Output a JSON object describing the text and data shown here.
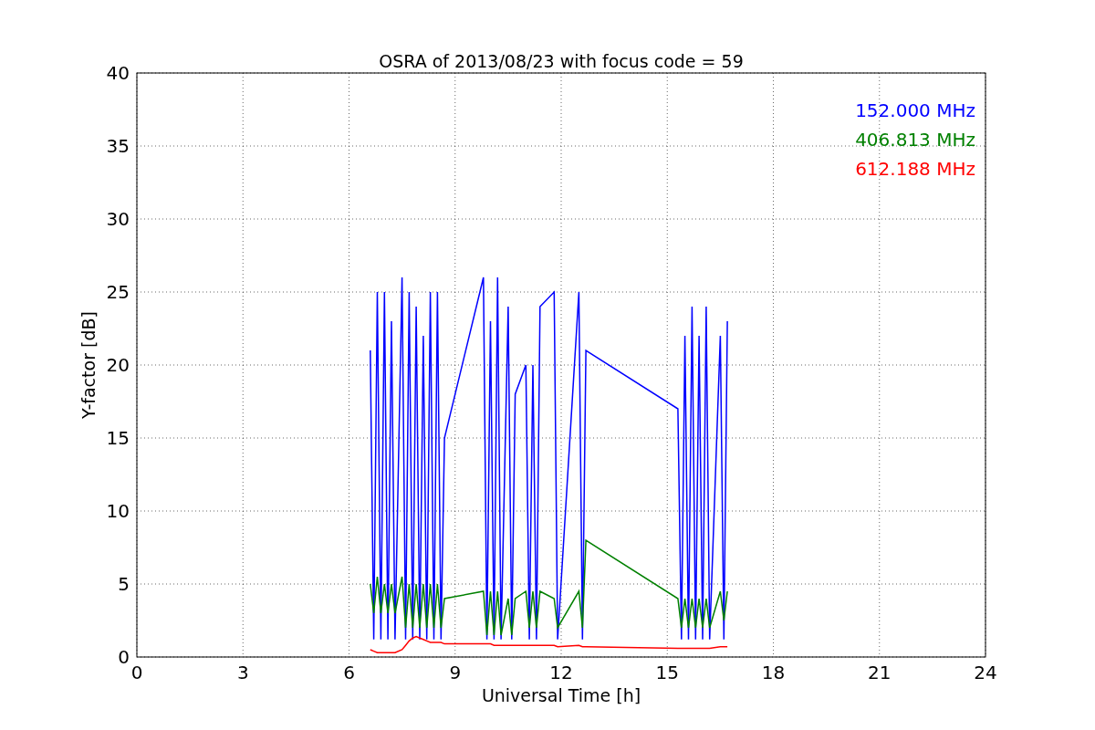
{
  "figure": {
    "chart_data": {
      "type": "line",
      "title": "OSRA of 2013/08/23 with focus code = 59",
      "xlabel": "Universal Time [h]",
      "ylabel": "Y-factor [dB]",
      "x": [
        6.6,
        6.7,
        6.8,
        6.9,
        7.0,
        7.1,
        7.2,
        7.3,
        7.5,
        7.6,
        7.7,
        7.8,
        7.9,
        8.0,
        8.1,
        8.2,
        8.3,
        8.4,
        8.5,
        8.6,
        8.7,
        9.8,
        9.9,
        10.0,
        10.1,
        10.2,
        10.3,
        10.5,
        10.6,
        10.7,
        11.0,
        11.1,
        11.2,
        11.3,
        11.4,
        11.8,
        11.9,
        12.5,
        12.6,
        12.7,
        15.3,
        15.4,
        15.5,
        15.6,
        15.7,
        15.8,
        15.9,
        16.0,
        16.1,
        16.2,
        16.5,
        16.6,
        16.7
      ],
      "series": [
        {
          "name": "152.000 MHz",
          "color": "#0000ff",
          "values": [
            21,
            1.2,
            25,
            1.2,
            25,
            1.2,
            23,
            1.2,
            26,
            1.2,
            25,
            1.2,
            24,
            1.2,
            22,
            1.2,
            25,
            1.2,
            25,
            1.2,
            15,
            26,
            1.2,
            23,
            1.2,
            26,
            1.2,
            24,
            1.2,
            18,
            20,
            1.2,
            20,
            1.2,
            24,
            25,
            1.2,
            25,
            1.2,
            21,
            17,
            1.2,
            22,
            1.2,
            24,
            1.2,
            22,
            1.2,
            24,
            1.2,
            22,
            1.2,
            23
          ]
        },
        {
          "name": "406.813 MHz",
          "color": "#008000",
          "values": [
            5,
            3,
            5.5,
            3,
            5,
            3,
            5,
            3,
            5.5,
            2,
            5,
            2,
            5,
            2,
            5,
            2,
            5,
            2,
            5,
            2,
            4,
            4.5,
            1.5,
            4.5,
            1.5,
            4.5,
            1.5,
            4,
            1.5,
            4,
            4.5,
            2,
            4.5,
            2,
            4.5,
            4,
            2,
            4.5,
            2,
            8,
            4,
            2,
            4,
            2,
            4,
            2,
            4,
            2,
            4,
            2,
            4.5,
            2.5,
            4.5
          ]
        },
        {
          "name": "612.188 MHz",
          "color": "#ff0000",
          "values": [
            0.5,
            0.4,
            0.3,
            0.3,
            0.3,
            0.3,
            0.3,
            0.3,
            0.5,
            0.8,
            1.1,
            1.3,
            1.4,
            1.3,
            1.2,
            1.1,
            1.0,
            1.0,
            1.0,
            1.0,
            0.9,
            0.9,
            0.9,
            0.9,
            0.8,
            0.8,
            0.8,
            0.8,
            0.8,
            0.8,
            0.8,
            0.8,
            0.8,
            0.8,
            0.8,
            0.8,
            0.7,
            0.8,
            0.7,
            0.7,
            0.6,
            0.6,
            0.6,
            0.6,
            0.6,
            0.6,
            0.6,
            0.6,
            0.6,
            0.6,
            0.7,
            0.7,
            0.7
          ]
        }
      ],
      "grid": true,
      "xlim": [
        0,
        24
      ],
      "ylim": [
        0,
        40
      ],
      "xticks": [
        0,
        3,
        6,
        9,
        12,
        15,
        18,
        21,
        24
      ],
      "yticks": [
        0,
        5,
        10,
        15,
        20,
        25,
        30,
        35,
        40
      ]
    }
  }
}
